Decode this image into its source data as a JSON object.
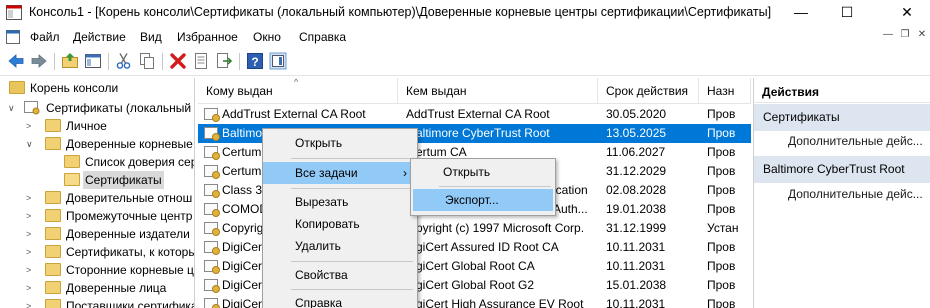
{
  "window": {
    "title": "Консоль1 - [Корень консоли\\Сертификаты (локальный компьютер)\\Доверенные корневые центры сертификации\\Сертификаты]",
    "minimize": "—",
    "maximize": "☐",
    "close": "✕"
  },
  "menu": [
    "Файл",
    "Действие",
    "Вид",
    "Избранное",
    "Окно",
    "Справка"
  ],
  "mdi_controls": [
    "—",
    "❐",
    "✕"
  ],
  "tree": [
    "Корень консоли",
    "Сертификаты (локальный к",
    "Личное",
    "Доверенные корневые ц",
    "Список доверия серт",
    "Сертификаты",
    "Доверительные отнош",
    "Промежуточные центр",
    "Доверенные издатели",
    "Сертификаты, к которы",
    "Сторонние корневые ц",
    "Доверенные лица",
    "Поставщики сертифика"
  ],
  "list": {
    "columns": [
      "Кому выдан",
      "Кем выдан",
      "Срок действия",
      "Назн"
    ],
    "rows": [
      {
        "to": "AddTrust External CA Root",
        "by": "AddTrust External CA Root",
        "exp": "30.05.2020",
        "purpose": "Пров"
      },
      {
        "to": "Baltimo",
        "by": "altimore CyberTrust Root",
        "exp": "13.05.2025",
        "purpose": "Пров"
      },
      {
        "to": "Certum",
        "by": "ertum CA",
        "exp": "11.06.2027",
        "purpose": "Пров"
      },
      {
        "to": "Certum",
        "by": "",
        "exp": "31.12.2029",
        "purpose": "Пров"
      },
      {
        "to": "Class 3",
        "by": "ication",
        "exp": "02.08.2028",
        "purpose": "Пров"
      },
      {
        "to": "COMOD",
        "by": "Auth...",
        "exp": "19.01.2038",
        "purpose": "Пров"
      },
      {
        "to": "Copyrig",
        "by": "pyright (c) 1997 Microsoft Corp.",
        "exp": "31.12.1999",
        "purpose": "Устан"
      },
      {
        "to": "DigiCert",
        "by": "giCert Assured ID Root CA",
        "exp": "10.11.2031",
        "purpose": "Пров"
      },
      {
        "to": "DigiCert",
        "by": "giCert Global Root CA",
        "exp": "10.11.2031",
        "purpose": "Пров"
      },
      {
        "to": "DigiCert",
        "by": "giCert Global Root G2",
        "exp": "15.01.2038",
        "purpose": "Пров"
      },
      {
        "to": "DigiCert",
        "by": "giCert High Assurance EV Root",
        "exp": "10.11.2031",
        "purpose": "Пров"
      }
    ]
  },
  "actions": {
    "title": "Действия",
    "section1": "Сертификаты",
    "link1": "Дополнительные дейс...",
    "section2": "Baltimore CyberTrust Root",
    "link2": "Дополнительные дейс..."
  },
  "context_menu": [
    "Открыть",
    "Все задачи",
    "Вырезать",
    "Копировать",
    "Удалить",
    "Свойства",
    "Справка"
  ],
  "submenu": [
    "Открыть",
    "Экспорт..."
  ],
  "colors": {
    "selection": "#0078d7",
    "menu_highlight": "#91c9f7",
    "action_section": "#dde6f0"
  }
}
